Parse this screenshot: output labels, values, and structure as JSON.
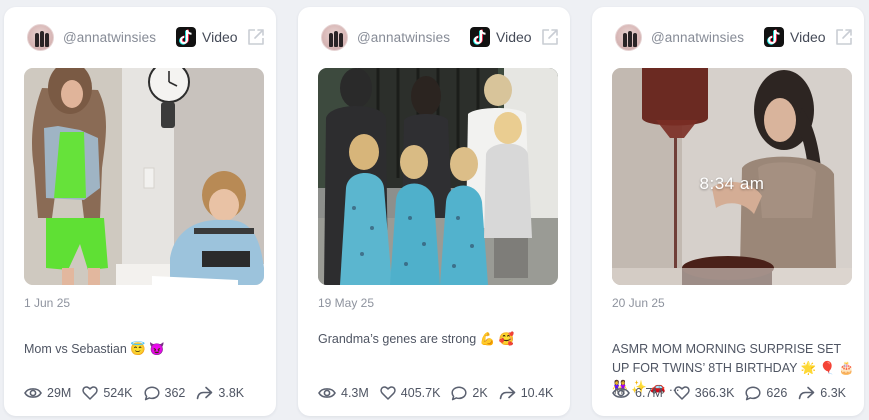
{
  "colors": {
    "page_background": "#eef0f4",
    "card_background": "#ffffff",
    "muted_text": "#8e939e",
    "body_text": "#4f5563"
  },
  "cards": [
    {
      "handle": "@annatwinsies",
      "platform_icon": "tiktok-icon",
      "content_type": "Video",
      "date": "1 Jun 25",
      "caption": "Mom vs Sebastian 😇 😈",
      "overlay_text": "",
      "stats": {
        "views": "29M",
        "likes": "524K",
        "comments": "362",
        "shares": "3.8K"
      }
    },
    {
      "handle": "@annatwinsies",
      "platform_icon": "tiktok-icon",
      "content_type": "Video",
      "date": "19 May 25",
      "caption": "Grandma’s genes are strong 💪 🥰",
      "overlay_text": "",
      "stats": {
        "views": "4.3M",
        "likes": "405.7K",
        "comments": "2K",
        "shares": "10.4K"
      }
    },
    {
      "handle": "@annatwinsies",
      "platform_icon": "tiktok-icon",
      "content_type": "Video",
      "date": "20 Jun 25",
      "caption": "ASMR MOM MORNING SURPRISE SET UP FOR TWINS’ 8TH BIRTHDAY 🌟 🎈 🎂 👭 ✨ 🚗 ...",
      "overlay_text": "8:34 am",
      "stats": {
        "views": "6.7M",
        "likes": "366.3K",
        "comments": "626",
        "shares": "6.3K"
      }
    }
  ]
}
